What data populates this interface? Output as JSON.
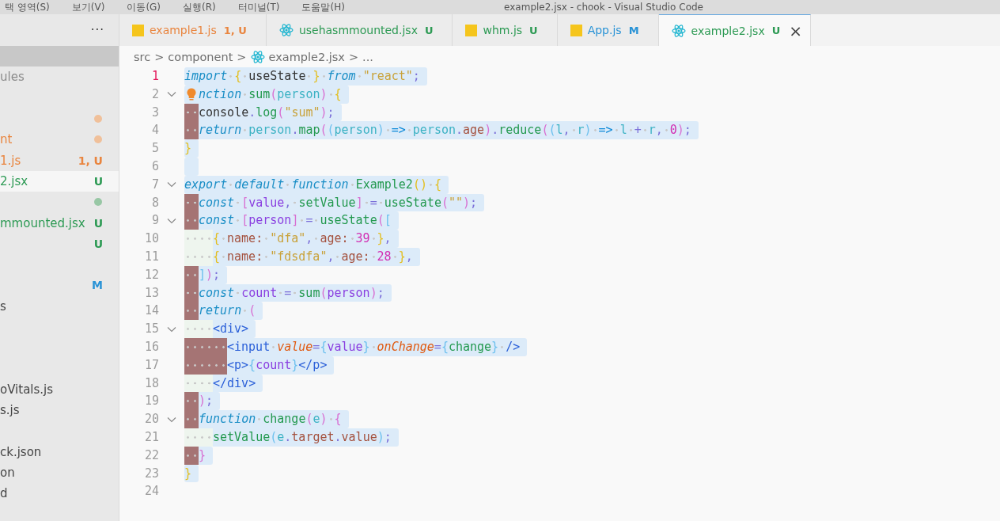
{
  "title_bar": {
    "menu": [
      "택 영역(S)",
      "보기(V)",
      "이동(G)",
      "실행(R)",
      "터미널(T)",
      "도움말(H)"
    ],
    "title": "example2.jsx - chook - Visual Studio Code"
  },
  "sidebar": {
    "more": "···",
    "rows": [
      {
        "hovered": true,
        "selected": false
      },
      {
        "label": "ules",
        "color": "#8c8c8c",
        "hovered": false,
        "selected": false
      },
      {
        "hovered": false,
        "selected": false
      },
      {
        "dot": {
          "color": "#f0c09a"
        },
        "hovered": false,
        "selected": false
      },
      {
        "label": "nt",
        "color": "#e9853f",
        "dot": {
          "color": "#f0c09a"
        },
        "hovered": false,
        "selected": false
      },
      {
        "label": "1.js",
        "badge": "1, U",
        "color": "#e9853f",
        "hovered": false,
        "selected": false
      },
      {
        "label": "2.jsx",
        "badge": "U",
        "color": "#2d9a54",
        "hovered": false,
        "selected": true
      },
      {
        "dot": {
          "color": "#98c7a5"
        },
        "hovered": false,
        "selected": false
      },
      {
        "label": "mmounted.jsx",
        "badge": "U",
        "color": "#2d9a54",
        "hovered": false,
        "selected": false
      },
      {
        "badge": "U",
        "color": "#2d9a54",
        "hovered": false,
        "selected": false
      },
      {
        "hovered": false,
        "selected": false
      },
      {
        "badge": "M",
        "color": "#2a93d6",
        "hovered": false,
        "selected": false
      },
      {
        "label": "s",
        "color": "#444444",
        "hovered": false,
        "selected": false
      },
      {
        "hovered": false,
        "selected": false
      },
      {
        "hovered": false,
        "selected": false
      },
      {
        "hovered": false,
        "selected": false
      },
      {
        "label": "oVitals.js",
        "color": "#444444",
        "hovered": false,
        "selected": false
      },
      {
        "label": "s.js",
        "color": "#444444",
        "hovered": false,
        "selected": false
      },
      {
        "hovered": false,
        "selected": false
      },
      {
        "label": "ck.json",
        "color": "#444444",
        "hovered": false,
        "selected": false
      },
      {
        "label": "on",
        "color": "#444444",
        "hovered": false,
        "selected": false
      },
      {
        "label": "d",
        "color": "#444444",
        "hovered": false,
        "selected": false
      }
    ]
  },
  "tabs": [
    {
      "kind": "js",
      "label": "example1.js",
      "badge": "1, U",
      "color": "#e9853f",
      "selected": false
    },
    {
      "kind": "react",
      "label": "usehasmmounted.jsx",
      "badge": "U",
      "color": "#2d9a54",
      "selected": false
    },
    {
      "kind": "js",
      "label": "whm.js",
      "badge": "U",
      "color": "#2d9a54",
      "selected": false
    },
    {
      "kind": "js",
      "label": "App.js",
      "badge": "M",
      "color": "#2a93d6",
      "selected": false
    },
    {
      "kind": "react",
      "label": "example2.jsx",
      "badge": "U",
      "color": "#2d9a54",
      "selected": true,
      "close": "×"
    }
  ],
  "breadcrumb": [
    {
      "kind": "text",
      "text": "src"
    },
    {
      "kind": "sep",
      "text": ">"
    },
    {
      "kind": "text",
      "text": "component"
    },
    {
      "kind": "sep",
      "text": ">"
    },
    {
      "kind": "react"
    },
    {
      "kind": "text",
      "text": "example2.jsx"
    },
    {
      "kind": "sep",
      "text": ">"
    },
    {
      "kind": "text",
      "text": "..."
    }
  ],
  "editor": {
    "lines": [
      {
        "number": "1",
        "current": true,
        "foldable": false,
        "selected": true,
        "tokens": [
          {
            "kind": "kw",
            "text": "import",
            "space": true
          },
          {
            "kind": "brace",
            "text": "{",
            "space": true
          },
          {
            "kind": "ident",
            "text": "useState",
            "space": true
          },
          {
            "kind": "brace",
            "text": "}",
            "space": true
          },
          {
            "kind": "kw",
            "text": "from",
            "space": true
          },
          {
            "kind": "str",
            "text": "\"react\""
          },
          {
            "kind": "punct",
            "text": ";"
          }
        ]
      },
      {
        "number": "2",
        "current": false,
        "foldable": true,
        "selected": true,
        "lightbulb": true,
        "tokens": [
          {
            "kind": "kw",
            "text": "nction",
            "space": true
          },
          {
            "kind": "fn",
            "text": "sum"
          },
          {
            "kind": "paren",
            "text": "("
          },
          {
            "kind": "param",
            "text": "person"
          },
          {
            "kind": "paren",
            "text": ")",
            "space": true
          },
          {
            "kind": "brace",
            "text": "{"
          }
        ]
      },
      {
        "number": "3",
        "current": false,
        "foldable": false,
        "selected": true,
        "indent": [
          {
            "error": true
          }
        ],
        "tokens": [
          {
            "kind": "ident",
            "text": "console"
          },
          {
            "kind": "punct",
            "text": "."
          },
          {
            "kind": "fn",
            "text": "log"
          },
          {
            "kind": "paren",
            "text": "("
          },
          {
            "kind": "str",
            "text": "\"sum\""
          },
          {
            "kind": "paren",
            "text": ")"
          },
          {
            "kind": "punct",
            "text": ";"
          }
        ]
      },
      {
        "number": "4",
        "current": false,
        "foldable": false,
        "selected": true,
        "indent": [
          {
            "error": true
          }
        ],
        "tokens": [
          {
            "kind": "kw",
            "text": "return",
            "space": true
          },
          {
            "kind": "param",
            "text": "person"
          },
          {
            "kind": "punct",
            "text": "."
          },
          {
            "kind": "fn",
            "text": "map"
          },
          {
            "kind": "paren",
            "text": "("
          },
          {
            "kind": "paren2",
            "text": "("
          },
          {
            "kind": "param",
            "text": "person"
          },
          {
            "kind": "paren2",
            "text": ")",
            "space": true
          },
          {
            "kind": "arrow",
            "text": "=>",
            "space": true
          },
          {
            "kind": "param",
            "text": "person"
          },
          {
            "kind": "punct",
            "text": "."
          },
          {
            "kind": "prop",
            "text": "age"
          },
          {
            "kind": "paren",
            "text": ")"
          },
          {
            "kind": "punct",
            "text": "."
          },
          {
            "kind": "fn",
            "text": "reduce"
          },
          {
            "kind": "paren",
            "text": "("
          },
          {
            "kind": "paren2",
            "text": "("
          },
          {
            "kind": "param",
            "text": "l"
          },
          {
            "kind": "punct",
            "text": ",",
            "space": true
          },
          {
            "kind": "param",
            "text": "r"
          },
          {
            "kind": "paren2",
            "text": ")",
            "space": true
          },
          {
            "kind": "arrow",
            "text": "=>",
            "space": true
          },
          {
            "kind": "param",
            "text": "l",
            "space": true
          },
          {
            "kind": "punct",
            "text": "+",
            "space": true
          },
          {
            "kind": "param",
            "text": "r"
          },
          {
            "kind": "punct",
            "text": ",",
            "space": true
          },
          {
            "kind": "num",
            "text": "0"
          },
          {
            "kind": "paren",
            "text": ")"
          },
          {
            "kind": "punct",
            "text": ";"
          }
        ]
      },
      {
        "number": "5",
        "current": false,
        "foldable": false,
        "selected": true,
        "tokens": [
          {
            "kind": "brace",
            "text": "}"
          }
        ]
      },
      {
        "number": "6",
        "current": false,
        "foldable": false,
        "selected": true
      },
      {
        "number": "7",
        "current": false,
        "foldable": true,
        "selected": true,
        "tokens": [
          {
            "kind": "kw",
            "text": "export",
            "space": true
          },
          {
            "kind": "kw",
            "text": "default",
            "space": true
          },
          {
            "kind": "kw",
            "text": "function",
            "space": true
          },
          {
            "kind": "fn",
            "text": "Example2"
          },
          {
            "kind": "brace",
            "text": "()",
            "space": true
          },
          {
            "kind": "brace",
            "text": "{"
          }
        ]
      },
      {
        "number": "8",
        "current": false,
        "foldable": false,
        "selected": true,
        "indent": [
          {
            "error": true
          }
        ],
        "tokens": [
          {
            "kind": "kw",
            "text": "const",
            "space": true
          },
          {
            "kind": "paren",
            "text": "["
          },
          {
            "kind": "var",
            "text": "value"
          },
          {
            "kind": "punct",
            "text": ",",
            "space": true
          },
          {
            "kind": "fn",
            "text": "setValue"
          },
          {
            "kind": "paren",
            "text": "]",
            "space": true
          },
          {
            "kind": "punct",
            "text": "=",
            "space": true
          },
          {
            "kind": "fn",
            "text": "useState"
          },
          {
            "kind": "paren",
            "text": "("
          },
          {
            "kind": "str",
            "text": "\"\""
          },
          {
            "kind": "paren",
            "text": ")"
          },
          {
            "kind": "punct",
            "text": ";"
          }
        ]
      },
      {
        "number": "9",
        "current": false,
        "foldable": true,
        "selected": true,
        "indent": [
          {
            "error": true
          }
        ],
        "tokens": [
          {
            "kind": "kw",
            "text": "const",
            "space": true
          },
          {
            "kind": "paren",
            "text": "["
          },
          {
            "kind": "var",
            "text": "person"
          },
          {
            "kind": "paren",
            "text": "]",
            "space": true
          },
          {
            "kind": "punct",
            "text": "=",
            "space": true
          },
          {
            "kind": "fn",
            "text": "useState"
          },
          {
            "kind": "paren",
            "text": "("
          },
          {
            "kind": "paren2",
            "text": "["
          }
        ]
      },
      {
        "number": "10",
        "current": false,
        "foldable": false,
        "selected": true,
        "indent": [
          {
            "error": false
          },
          {
            "error": false
          }
        ],
        "tokens": [
          {
            "kind": "brace",
            "text": "{",
            "space": true
          },
          {
            "kind": "prop",
            "text": "name:",
            "space": true
          },
          {
            "kind": "str",
            "text": "\"dfa\""
          },
          {
            "kind": "punct",
            "text": ",",
            "space": true
          },
          {
            "kind": "prop",
            "text": "age:",
            "space": true
          },
          {
            "kind": "num",
            "text": "39",
            "space": true
          },
          {
            "kind": "brace",
            "text": "}"
          },
          {
            "kind": "punct",
            "text": ","
          }
        ]
      },
      {
        "number": "11",
        "current": false,
        "foldable": false,
        "selected": true,
        "indent": [
          {
            "error": false
          },
          {
            "error": false
          }
        ],
        "tokens": [
          {
            "kind": "brace",
            "text": "{",
            "space": true
          },
          {
            "kind": "prop",
            "text": "name:",
            "space": true
          },
          {
            "kind": "str",
            "text": "\"fdsdfa\""
          },
          {
            "kind": "punct",
            "text": ",",
            "space": true
          },
          {
            "kind": "prop",
            "text": "age:",
            "space": true
          },
          {
            "kind": "num",
            "text": "28",
            "space": true
          },
          {
            "kind": "brace",
            "text": "}"
          },
          {
            "kind": "punct",
            "text": ","
          }
        ]
      },
      {
        "number": "12",
        "current": false,
        "foldable": false,
        "selected": true,
        "indent": [
          {
            "error": true
          }
        ],
        "tokens": [
          {
            "kind": "paren2",
            "text": "]"
          },
          {
            "kind": "paren",
            "text": ")"
          },
          {
            "kind": "punct",
            "text": ";"
          }
        ]
      },
      {
        "number": "13",
        "current": false,
        "foldable": false,
        "selected": true,
        "indent": [
          {
            "error": true
          }
        ],
        "tokens": [
          {
            "kind": "kw",
            "text": "const",
            "space": true
          },
          {
            "kind": "var",
            "text": "count",
            "space": true
          },
          {
            "kind": "punct",
            "text": "=",
            "space": true
          },
          {
            "kind": "fn",
            "text": "sum"
          },
          {
            "kind": "paren",
            "text": "("
          },
          {
            "kind": "var",
            "text": "person"
          },
          {
            "kind": "paren",
            "text": ")"
          },
          {
            "kind": "punct",
            "text": ";"
          }
        ]
      },
      {
        "number": "14",
        "current": false,
        "foldable": false,
        "selected": true,
        "indent": [
          {
            "error": true
          }
        ],
        "tokens": [
          {
            "kind": "kw",
            "text": "return",
            "space": true
          },
          {
            "kind": "paren",
            "text": "("
          }
        ]
      },
      {
        "number": "15",
        "current": false,
        "foldable": true,
        "selected": true,
        "indent": [
          {
            "error": false
          },
          {
            "error": false
          }
        ],
        "tokens": [
          {
            "kind": "tag",
            "text": "<div>"
          }
        ]
      },
      {
        "number": "16",
        "current": false,
        "foldable": false,
        "selected": true,
        "indent": [
          {
            "error": true
          },
          {
            "error": true
          },
          {
            "error": true
          }
        ],
        "tokens": [
          {
            "kind": "tag",
            "text": "<input",
            "space": true
          },
          {
            "kind": "attr",
            "text": "value"
          },
          {
            "kind": "punct",
            "text": "="
          },
          {
            "kind": "paren2",
            "text": "{"
          },
          {
            "kind": "var",
            "text": "value"
          },
          {
            "kind": "paren2",
            "text": "}",
            "space": true
          },
          {
            "kind": "attr",
            "text": "onChange"
          },
          {
            "kind": "punct",
            "text": "="
          },
          {
            "kind": "paren2",
            "text": "{"
          },
          {
            "kind": "fn",
            "text": "change"
          },
          {
            "kind": "paren2",
            "text": "}",
            "space": true
          },
          {
            "kind": "tag",
            "text": "/>"
          }
        ]
      },
      {
        "number": "17",
        "current": false,
        "foldable": false,
        "selected": true,
        "indent": [
          {
            "error": true
          },
          {
            "error": true
          },
          {
            "error": true
          }
        ],
        "tokens": [
          {
            "kind": "tag",
            "text": "<p>"
          },
          {
            "kind": "paren2",
            "text": "{"
          },
          {
            "kind": "var",
            "text": "count"
          },
          {
            "kind": "paren2",
            "text": "}"
          },
          {
            "kind": "tag",
            "text": "</p>"
          }
        ]
      },
      {
        "number": "18",
        "current": false,
        "foldable": false,
        "selected": true,
        "indent": [
          {
            "error": false
          },
          {
            "error": false
          }
        ],
        "tokens": [
          {
            "kind": "tag",
            "text": "</div>"
          }
        ]
      },
      {
        "number": "19",
        "current": false,
        "foldable": false,
        "selected": true,
        "indent": [
          {
            "error": true
          }
        ],
        "tokens": [
          {
            "kind": "paren",
            "text": ")"
          },
          {
            "kind": "punct",
            "text": ";"
          }
        ]
      },
      {
        "number": "20",
        "current": false,
        "foldable": true,
        "selected": true,
        "indent": [
          {
            "error": true
          }
        ],
        "tokens": [
          {
            "kind": "kw",
            "text": "function",
            "space": true
          },
          {
            "kind": "fn",
            "text": "change"
          },
          {
            "kind": "paren",
            "text": "("
          },
          {
            "kind": "param",
            "text": "e"
          },
          {
            "kind": "paren",
            "text": ")",
            "space": true
          },
          {
            "kind": "paren",
            "text": "{"
          }
        ]
      },
      {
        "number": "21",
        "current": false,
        "foldable": false,
        "selected": true,
        "indent": [
          {
            "error": false
          },
          {
            "error": false
          }
        ],
        "tokens": [
          {
            "kind": "fn",
            "text": "setValue"
          },
          {
            "kind": "paren2",
            "text": "("
          },
          {
            "kind": "param",
            "text": "e"
          },
          {
            "kind": "punct",
            "text": "."
          },
          {
            "kind": "prop",
            "text": "target"
          },
          {
            "kind": "punct",
            "text": "."
          },
          {
            "kind": "prop",
            "text": "value"
          },
          {
            "kind": "paren2",
            "text": ")"
          },
          {
            "kind": "punct",
            "text": ";"
          }
        ]
      },
      {
        "number": "22",
        "current": false,
        "foldable": false,
        "selected": true,
        "indent": [
          {
            "error": true
          }
        ],
        "tokens": [
          {
            "kind": "paren",
            "text": "}"
          }
        ]
      },
      {
        "number": "23",
        "current": false,
        "foldable": false,
        "selected": true,
        "tokens": [
          {
            "kind": "brace",
            "text": "}"
          }
        ]
      },
      {
        "number": "24",
        "current": false,
        "foldable": false,
        "selected": false
      }
    ]
  }
}
